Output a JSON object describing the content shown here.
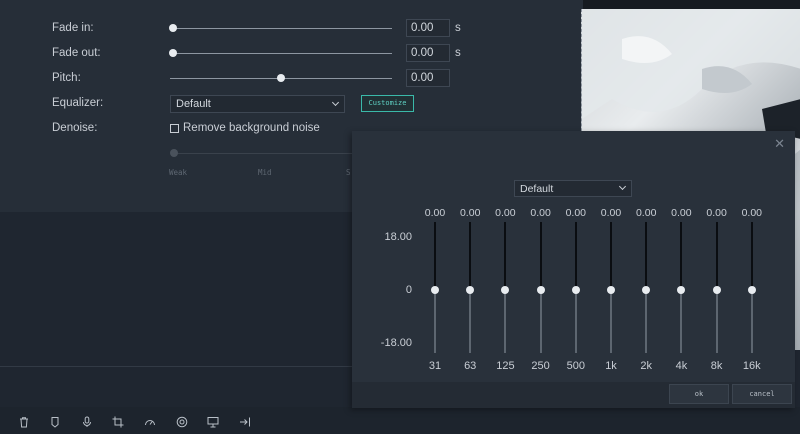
{
  "audio": {
    "fade_in": {
      "label": "Fade in:",
      "value": "0.00",
      "unit": "s",
      "level": 0
    },
    "fade_out": {
      "label": "Fade out:",
      "value": "0.00",
      "unit": "s",
      "level": 0
    },
    "pitch": {
      "label": "Pitch:",
      "value": "0.00",
      "level": 0.5
    },
    "equalizer": {
      "label": "Equalizer:",
      "selected": "Default",
      "customize_label": "Customize"
    },
    "denoise": {
      "label": "Denoise:",
      "checkbox_label": "Remove background noise",
      "checked": false,
      "levels": [
        "Weak",
        "Mid",
        "S"
      ]
    }
  },
  "equalizer_dialog": {
    "close_glyph": "✕",
    "preset": "Default",
    "db_labels": [
      "18.00",
      "0",
      "-18.00"
    ],
    "bands": [
      {
        "freq": "31",
        "value": "0.00"
      },
      {
        "freq": "63",
        "value": "0.00"
      },
      {
        "freq": "125",
        "value": "0.00"
      },
      {
        "freq": "250",
        "value": "0.00"
      },
      {
        "freq": "500",
        "value": "0.00"
      },
      {
        "freq": "1k",
        "value": "0.00"
      },
      {
        "freq": "2k",
        "value": "0.00"
      },
      {
        "freq": "4k",
        "value": "0.00"
      },
      {
        "freq": "8k",
        "value": "0.00"
      },
      {
        "freq": "16k",
        "value": "0.00"
      }
    ],
    "ok_label": "ok",
    "cancel_label": "cancel"
  },
  "toolbar": {
    "icons": [
      "trash-icon",
      "marker-icon",
      "microphone-icon",
      "crop-icon",
      "speed-icon",
      "color-icon",
      "presentation-icon",
      "export-icon"
    ]
  },
  "colors": {
    "accent": "#3ab9a9",
    "panel": "#262e38",
    "background": "#1f2630"
  }
}
